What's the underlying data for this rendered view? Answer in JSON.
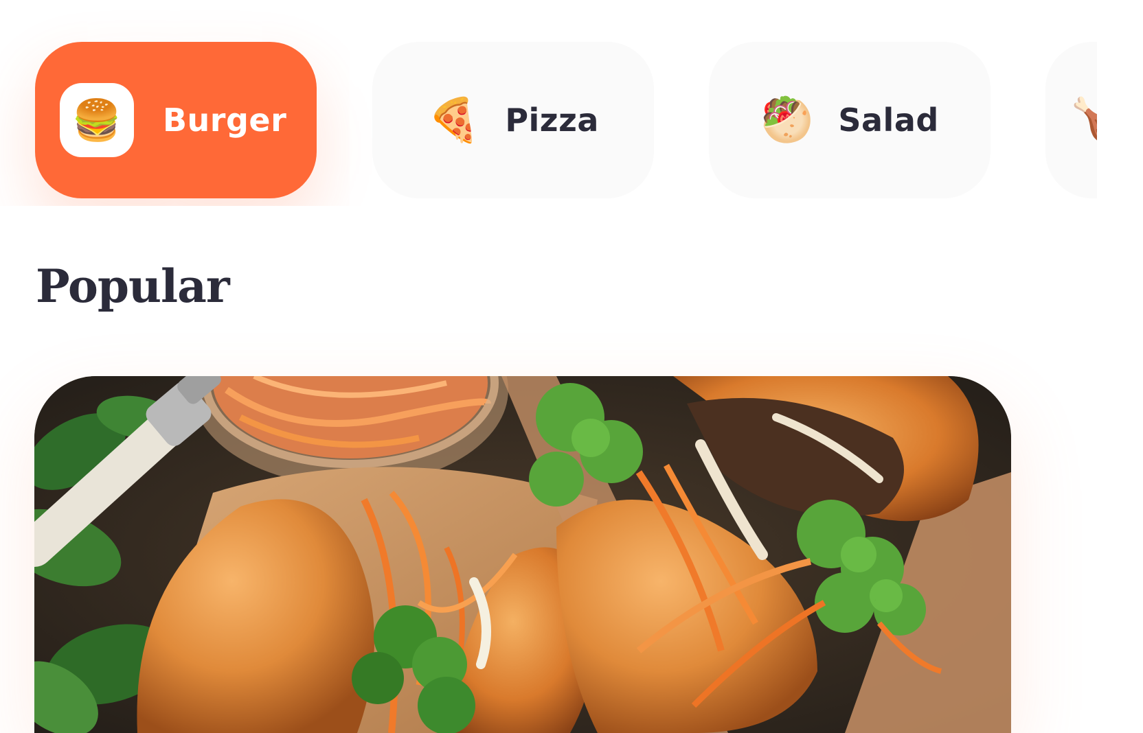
{
  "categories": [
    {
      "label": "Burger",
      "emoji": "🍔",
      "icon": "burger-icon",
      "active": true
    },
    {
      "label": "Pizza",
      "emoji": "🍕",
      "icon": "pizza-icon",
      "active": false
    },
    {
      "label": "Salad",
      "emoji": "🥙",
      "icon": "salad-icon",
      "active": false
    },
    {
      "label": "",
      "emoji": "🍗",
      "icon": "chicken-icon",
      "active": false
    }
  ],
  "popular": {
    "title": "Popular"
  },
  "colors": {
    "accent": "#ff6937",
    "chip_background": "#fafafa",
    "text_dark": "#2b2b3a"
  }
}
